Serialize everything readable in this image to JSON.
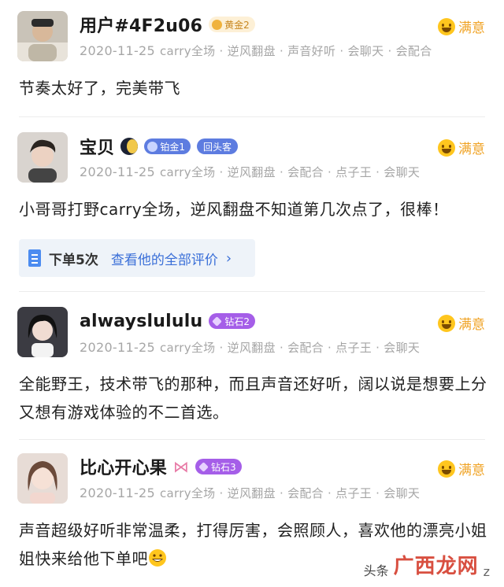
{
  "reviews": [
    {
      "username": "用户#4F2u06",
      "badges": [
        "黄金2"
      ],
      "date": "2020-11-25",
      "tags": "carry全场 · 逆风翻盘 · 声音好听 · 会聊天 · 会配合",
      "rating": "满意",
      "comment": "节奏太好了，完美带飞"
    },
    {
      "username": "宝贝",
      "badges": [
        "铂金1",
        "回头客"
      ],
      "date": "2020-11-25",
      "tags": "carry全场 · 逆风翻盘 · 会配合 · 点子王 · 会聊天",
      "rating": "满意",
      "comment": "小哥哥打野carry全场，逆风翻盘不知道第几次点了，很棒！",
      "orders": "下单5次",
      "view_all": "查看他的全部评价"
    },
    {
      "username": "alwayslululu",
      "badges": [
        "钻石2"
      ],
      "date": "2020-11-25",
      "tags": "carry全场 · 逆风翻盘 · 会配合 · 点子王 · 会聊天",
      "rating": "满意",
      "comment": "全能野王，技术带飞的那种，而且声音还好听，阔以说是想要上分又想有游戏体验的不二首选。"
    },
    {
      "username": "比心开心果",
      "badges": [
        "钻石3"
      ],
      "date": "2020-11-25",
      "tags": "carry全场 · 逆风翻盘 · 会配合 · 点子王 · 会聊天",
      "rating": "满意",
      "comment": "声音超级好听非常温柔，打得厉害，会照顾人，喜欢他的漂亮小姐姐快来给他下单吧"
    }
  ],
  "watermark": {
    "prefix": "头条",
    "brand": "广西龙网",
    "suffix": "z"
  },
  "colors": {
    "rating": "#f0a325",
    "link": "#3a6fd8",
    "meta": "#a6a6a6"
  }
}
